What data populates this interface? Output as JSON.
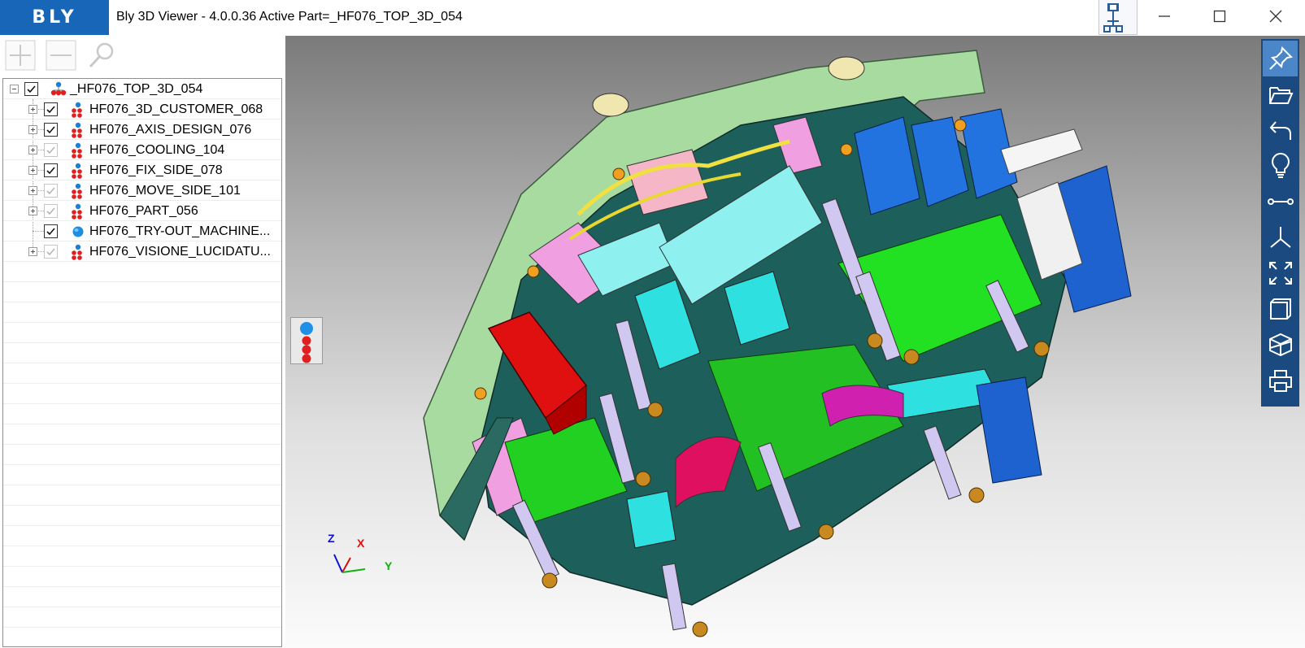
{
  "window": {
    "logo_text": "BLY",
    "title": "Bly 3D Viewer - 4.0.0.36 Active Part=_HF076_TOP_3D_054"
  },
  "tree_toolbar": {
    "icons": [
      "plus-icon",
      "minus-icon",
      "search-icon"
    ]
  },
  "tree": {
    "root": {
      "label": "_HF076_TOP_3D_054",
      "checked": true,
      "expanded": true
    },
    "children": [
      {
        "label": "HF076_3D_CUSTOMER_068",
        "checked": true,
        "has_children": true
      },
      {
        "label": "HF076_AXIS_DESIGN_076",
        "checked": true,
        "has_children": true
      },
      {
        "label": "HF076_COOLING_104",
        "checked": true,
        "dim": true,
        "has_children": true
      },
      {
        "label": "HF076_FIX_SIDE_078",
        "checked": true,
        "has_children": true
      },
      {
        "label": "HF076_MOVE_SIDE_101",
        "checked": true,
        "dim": true,
        "has_children": true
      },
      {
        "label": "HF076_PART_056",
        "checked": true,
        "dim": true,
        "has_children": true
      },
      {
        "label": "HF076_TRY-OUT_MACHINE...",
        "checked": true,
        "has_children": false
      },
      {
        "label": "HF076_VISIONE_LUCIDATU...",
        "checked": true,
        "dim": true,
        "has_children": true
      }
    ]
  },
  "axis_triad": {
    "z": "Z",
    "x": "X",
    "y": "Y"
  },
  "right_toolbar": {
    "icons": [
      "pin-icon",
      "open-folder-icon",
      "undo-icon",
      "lightbulb-icon",
      "measure-distance-icon",
      "axes-icon",
      "fit-view-icon",
      "view-frame-icon",
      "section-cube-icon",
      "print-icon"
    ]
  },
  "colors": {
    "brand": "#1766b8",
    "toolbar_dark": "#1a4a80",
    "toolbar_active": "#4b86c8"
  }
}
